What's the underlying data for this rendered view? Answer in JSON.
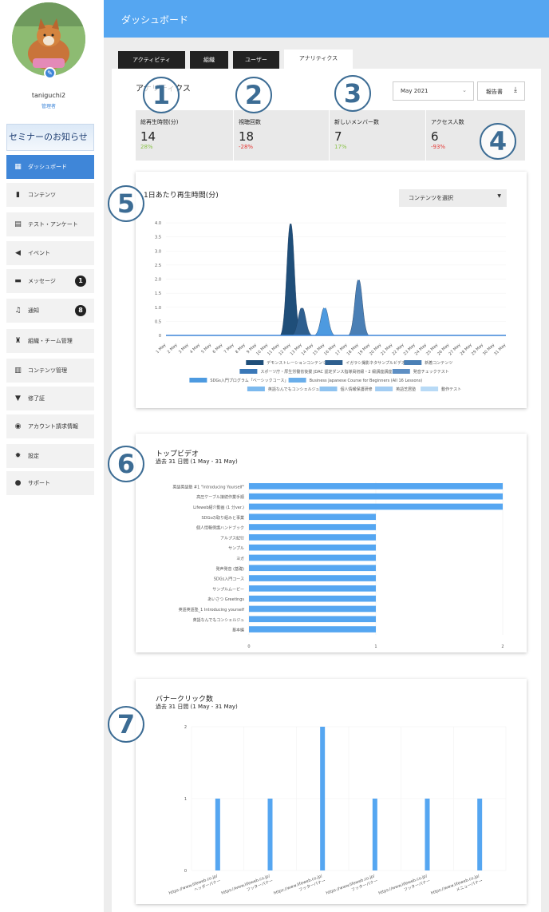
{
  "sidebar": {
    "user": {
      "name": "taniguchi2",
      "role": "管理者"
    },
    "banner": "セミナーのお知らせ",
    "items": [
      {
        "label": "ダッシュボード",
        "icon": "dashboard-icon",
        "active": true
      },
      {
        "label": "コンテンツ",
        "icon": "book-icon"
      },
      {
        "label": "テスト・アンケート",
        "icon": "test-icon"
      },
      {
        "label": "イベント",
        "icon": "megaphone-icon"
      },
      {
        "label": "メッセージ",
        "icon": "message-icon",
        "badge": "1"
      },
      {
        "label": "通知",
        "icon": "bell-icon",
        "badge": "8"
      },
      {
        "label": "組織・チーム管理",
        "icon": "people-icon"
      },
      {
        "label": "コンテンツ管理",
        "icon": "content-manage-icon"
      },
      {
        "label": "修了証",
        "icon": "certificate-icon"
      },
      {
        "label": "アカウント請求情報",
        "icon": "billing-icon"
      },
      {
        "label": "設定",
        "icon": "gear-icon"
      },
      {
        "label": "サポート",
        "icon": "info-icon"
      }
    ]
  },
  "header": {
    "title": "ダッシュボード"
  },
  "tabs": [
    {
      "label": "アクティビティ"
    },
    {
      "label": "組織"
    },
    {
      "label": "ユーザー"
    },
    {
      "label": "アナリティクス",
      "active": true
    }
  ],
  "analytics": {
    "title": "アナリティクス",
    "month": "May 2021",
    "report_button": "報告書",
    "stats": [
      {
        "label": "総再生時間(分)",
        "value": "14",
        "change": "28%",
        "color": "#8bc34a"
      },
      {
        "label": "視聴回数",
        "value": "18",
        "change": "-28%",
        "color": "#e53935"
      },
      {
        "label": "新しいメンバー数",
        "value": "7",
        "change": "17%",
        "color": "#8bc34a"
      },
      {
        "label": "アクセス人数",
        "value": "6",
        "change": "-93%",
        "color": "#e53935"
      }
    ]
  },
  "markers": [
    "1",
    "2",
    "3",
    "4",
    "5",
    "6",
    "7"
  ],
  "chart_data": [
    {
      "type": "area",
      "title": "1日あたり再生時間(分)",
      "selector": "コンテンツを選択",
      "x": [
        "1 May",
        "2 May",
        "3 May",
        "4 May",
        "5 May",
        "6 May",
        "7 May",
        "8 May",
        "9 May",
        "10 May",
        "11 May",
        "12 May",
        "13 May",
        "14 May",
        "15 May",
        "16 May",
        "17 May",
        "18 May",
        "19 May",
        "20 May",
        "21 May",
        "22 May",
        "23 May",
        "24 May",
        "25 May",
        "26 May",
        "27 May",
        "28 May",
        "29 May",
        "30 May",
        "31 May"
      ],
      "yticks": [
        "0",
        "0.5",
        "1.0",
        "1.5",
        "2.0",
        "2.5",
        "3.0",
        "3.5",
        "4.0"
      ],
      "ylim": [
        0,
        4
      ],
      "series": [
        {
          "name": "デモンストレーションコンテンツ",
          "color": "#1f4e79",
          "values": [
            0,
            0,
            0,
            0,
            0,
            0,
            0,
            0,
            0,
            0,
            0,
            4.0,
            0,
            0,
            0,
            0,
            0,
            0,
            0,
            0,
            0,
            0,
            0,
            0,
            0,
            0,
            0,
            0,
            0,
            0,
            0
          ]
        },
        {
          "name": "イガラシ撮影ネタサンプルビデオ",
          "color": "#2e5f8f",
          "values": [
            0,
            0,
            0,
            0,
            0,
            0,
            0,
            0,
            0,
            0,
            0,
            0,
            1.0,
            0,
            0,
            0,
            0,
            0,
            0,
            0,
            0,
            0,
            0,
            0,
            0,
            0,
            0,
            0,
            0,
            0,
            0
          ]
        },
        {
          "name": "新着コンテンツ",
          "color": "#4a7fb5",
          "values": [
            0,
            0,
            0,
            0,
            0,
            0,
            0,
            0,
            0,
            0,
            0,
            0,
            0,
            0,
            0,
            0,
            0,
            2.0,
            0,
            0,
            0,
            0,
            0,
            0,
            0,
            0,
            0,
            0,
            0,
            0,
            0
          ]
        },
        {
          "name": "スポーツ庁・厚生労働省後援 JDAC 認定ダンス指導員初級・2 級講座講座",
          "color": "#3a78b8",
          "values": [
            0,
            0,
            0,
            0,
            0,
            0,
            0,
            0,
            0,
            0,
            0,
            0,
            0,
            0,
            0,
            0,
            0,
            0,
            0,
            0,
            0,
            0,
            0,
            0,
            0,
            0,
            0,
            0,
            0,
            0,
            0
          ]
        },
        {
          "name": "発音チェックテスト",
          "color": "#5e8fc4",
          "values": [
            0,
            0,
            0,
            0,
            0,
            0,
            0,
            0,
            0,
            0,
            0,
            0,
            0,
            0,
            0,
            0,
            0,
            0,
            0,
            0,
            0,
            0,
            0,
            0,
            0,
            0,
            0,
            0,
            0,
            0,
            0
          ]
        },
        {
          "name": "SDGs入門プログラム「ベーシックコース」",
          "color": "#4d9ae0",
          "values": [
            0,
            0,
            0,
            0,
            0,
            0,
            0,
            0,
            0,
            0,
            0,
            0,
            0,
            0,
            1.0,
            0,
            0,
            0,
            0,
            0,
            0,
            0,
            0,
            0,
            0,
            0,
            0,
            0,
            0,
            0,
            0
          ]
        },
        {
          "name": "Business Japanese Course for Beginners (All 16 Lessons)",
          "color": "#6aaeea",
          "values": [
            0,
            0,
            0,
            0,
            0,
            0,
            0,
            0,
            0,
            0,
            0,
            0,
            0,
            0,
            0,
            0,
            0,
            0,
            0,
            0,
            0,
            0,
            0,
            0,
            0,
            0,
            0,
            0,
            0,
            0,
            0
          ]
        },
        {
          "name": "英語なんでもコンシェルジュ",
          "color": "#7cb9ee",
          "values": [
            0,
            0,
            0,
            0,
            0,
            0,
            0,
            0,
            0,
            0,
            0,
            0,
            0,
            0,
            0,
            0,
            0,
            0,
            0,
            0,
            0,
            0,
            0,
            0,
            0,
            0,
            0,
            0,
            0,
            0,
            0
          ]
        },
        {
          "name": "個人情報保護研修",
          "color": "#8fc3f0",
          "values": [
            0,
            0,
            0,
            0,
            0,
            0,
            0,
            0,
            0,
            0,
            0,
            0,
            0,
            0,
            0,
            0,
            0,
            0,
            0,
            0,
            0,
            0,
            0,
            0,
            0,
            0,
            0,
            0,
            0,
            0,
            0
          ]
        },
        {
          "name": "英語芝居塾",
          "color": "#a3cdf3",
          "values": [
            0,
            0,
            0,
            0,
            0,
            0,
            0,
            0,
            0,
            0,
            0,
            0,
            0,
            0,
            0,
            0,
            0,
            0,
            0,
            0,
            0,
            0,
            0,
            0,
            0,
            0,
            0,
            0,
            0,
            0,
            0
          ]
        },
        {
          "name": "動作テスト",
          "color": "#b8daf6",
          "values": [
            0,
            0,
            0,
            0,
            0,
            0,
            0,
            0,
            0,
            0,
            0,
            0,
            0,
            0,
            0,
            0,
            0,
            0,
            0,
            0,
            0,
            0,
            0,
            0,
            0,
            0,
            0,
            0,
            0,
            0,
            0
          ]
        }
      ]
    },
    {
      "type": "bar",
      "orientation": "horizontal",
      "title": "トップビデオ",
      "subtitle": "過去 31 日間 (1 May - 31 May)",
      "categories": [
        "英語英語塾 #1 \"Introducing Yourself\"",
        "高圧ケーブル接続作業手順",
        "Lifeweb紹介動画 (1 分ver.)",
        "SDGsの取り組みと事業",
        "個人情報保護ハンドブック",
        "アルプス紀行",
        "サンプル",
        "ヨガ",
        "発声発音 (基礎)",
        "SDGs入門コース",
        "サンプルムービー",
        "あいさつ Greetings",
        "英語英語塾_1 Introducing yourself",
        "英語なんでもコンシェルジュ",
        "基本編"
      ],
      "values": [
        2,
        2,
        2,
        1,
        1,
        1,
        1,
        1,
        1,
        1,
        1,
        1,
        1,
        1,
        1
      ],
      "xticks": [
        "0",
        "1",
        "2"
      ],
      "xlim": [
        0,
        2
      ],
      "color": "#55a6f1"
    },
    {
      "type": "bar",
      "title": "バナークリック数",
      "subtitle": "過去 31 日間 (1 May - 31 May)",
      "categories": [
        "https://www.lifeweb.co.jp/ ヘッダーバナー",
        "https://www.lifeweb.co.jp/ フッターバナー",
        "https://www.lifeweb.co.jp/ フッターバナー",
        "https://www.lifeweb.co.jp/ フッターバナー",
        "https://www.lifeweb.co.jp/ フッターバナー",
        "https://www.lifeweb.co.jp/ メニューバナー"
      ],
      "values": [
        1,
        1,
        2,
        1,
        1,
        1
      ],
      "yticks": [
        "0",
        "1",
        "2"
      ],
      "ylim": [
        0,
        2
      ],
      "color": "#55a6f1"
    }
  ]
}
